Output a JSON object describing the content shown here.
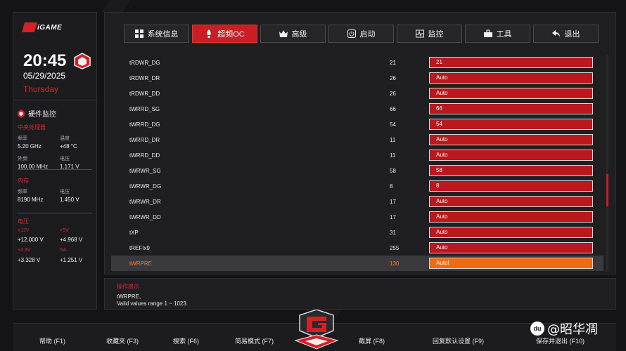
{
  "brand": {
    "name": "iGAME"
  },
  "clock": {
    "time": "20:45",
    "date": "05/29/2025",
    "weekday": "Thursday"
  },
  "hw_monitor": {
    "title": "硬件监控",
    "cpu": {
      "title": "中央处理器",
      "freq_label": "频率",
      "freq": "5.20 GHz",
      "temp_label": "温度",
      "temp": "+48 °C",
      "ext_label": "外频",
      "ext": "100.00 MHz",
      "volt_label": "电压",
      "volt": "1.171 V"
    },
    "memory": {
      "title": "内存",
      "freq_label": "频率",
      "freq": "8190 MHz",
      "volt_label": "电压",
      "volt": "1.450 V"
    },
    "voltage": {
      "title": "电压",
      "v12_label": "+12V",
      "v12": "+12.000 V",
      "v5_label": "+5V",
      "v5": "+4.968 V",
      "v33_label": "+3.3V",
      "v33": "+3.328 V",
      "sa_label": "SA",
      "sa": "+1.251 V"
    }
  },
  "tabs": [
    {
      "label": "系统信息",
      "icon": "grid-icon"
    },
    {
      "label": "超频OC",
      "icon": "rocket-icon",
      "active": true
    },
    {
      "label": "高级",
      "icon": "crown-icon"
    },
    {
      "label": "启动",
      "icon": "power-icon"
    },
    {
      "label": "监控",
      "icon": "pulse-icon"
    },
    {
      "label": "工具",
      "icon": "toolbox-icon"
    },
    {
      "label": "退出",
      "icon": "back-arrow-icon"
    }
  ],
  "rows": [
    {
      "name": "tRDWR_DG",
      "current": "21",
      "value": "21"
    },
    {
      "name": "tRDWR_DR",
      "current": "26",
      "value": "Auto"
    },
    {
      "name": "tRDWR_DD",
      "current": "26",
      "value": "Auto"
    },
    {
      "name": "tWRRD_SG",
      "current": "66",
      "value": "66"
    },
    {
      "name": "tWRRD_DG",
      "current": "54",
      "value": "54"
    },
    {
      "name": "tWRRD_DR",
      "current": "11",
      "value": "Auto"
    },
    {
      "name": "tWRRD_DD",
      "current": "11",
      "value": "Auto"
    },
    {
      "name": "tWRWR_SG",
      "current": "58",
      "value": "58"
    },
    {
      "name": "tWRWR_DG",
      "current": "8",
      "value": "8"
    },
    {
      "name": "tWRWR_DR",
      "current": "17",
      "value": "Auto"
    },
    {
      "name": "tWRWR_DD",
      "current": "17",
      "value": "Auto"
    },
    {
      "name": "tXP",
      "current": "31",
      "value": "Auto"
    },
    {
      "name": "tREFIx9",
      "current": "255",
      "value": "Auto"
    },
    {
      "name": "tWRPRE",
      "current": "130",
      "value": "Autol",
      "selected": true
    }
  ],
  "help": {
    "title": "操作提示",
    "line1": "tWRPRE,",
    "line2": "Valid values range 1 ~ 1023."
  },
  "bottom_keys": [
    {
      "label": "帮助 (F1)"
    },
    {
      "label": "收藏夹 (F3)"
    },
    {
      "label": "搜索 (F6)"
    },
    {
      "label": "简易模式 (F7)"
    },
    {
      "label": "截屏 (F8)"
    },
    {
      "label": "回复默认设置 (F9)"
    },
    {
      "label": "保存并退出 (F10)"
    }
  ],
  "watermark": {
    "badge": "du",
    "text": "@昭华凋"
  },
  "colors": {
    "accent": "#c81e24",
    "selected": "#ee6a14",
    "background": "#141416"
  }
}
